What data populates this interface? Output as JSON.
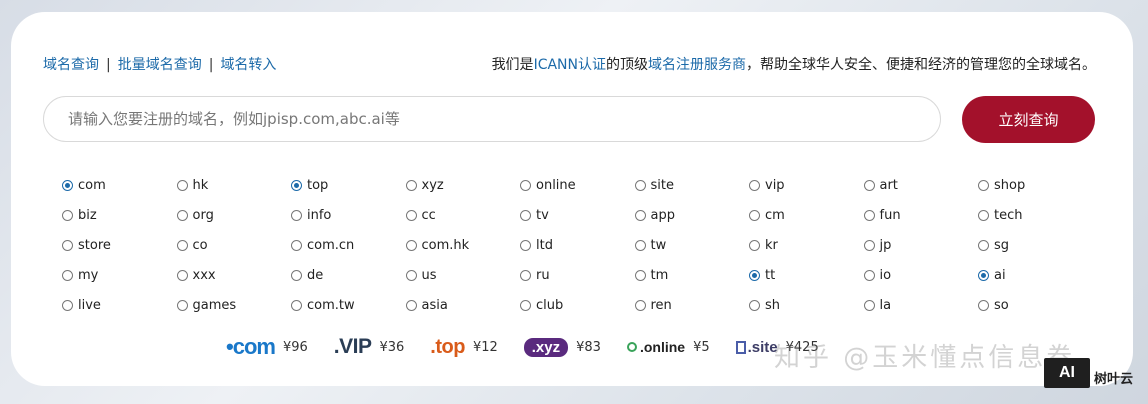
{
  "nav": {
    "links": [
      "域名查询",
      "批量域名查询",
      "域名转入"
    ],
    "separator": "|"
  },
  "slogan": {
    "pre": "我们是",
    "h1": "ICANN认证",
    "mid": "的顶级",
    "h2": "域名注册服务商",
    "post": "，帮助全球华人安全、便捷和经济的管理您的全球域名。"
  },
  "search": {
    "placeholder": "请输入您要注册的域名，例如jpisp.com,abc.ai等",
    "value": "",
    "button": "立刻查询"
  },
  "suffixes": [
    {
      "name": "com",
      "checked": true
    },
    {
      "name": "hk",
      "checked": false
    },
    {
      "name": "top",
      "checked": true
    },
    {
      "name": "xyz",
      "checked": false
    },
    {
      "name": "online",
      "checked": false
    },
    {
      "name": "site",
      "checked": false
    },
    {
      "name": "vip",
      "checked": false
    },
    {
      "name": "art",
      "checked": false
    },
    {
      "name": "shop",
      "checked": false
    },
    {
      "name": "biz",
      "checked": false
    },
    {
      "name": "org",
      "checked": false
    },
    {
      "name": "info",
      "checked": false
    },
    {
      "name": "cc",
      "checked": false
    },
    {
      "name": "tv",
      "checked": false
    },
    {
      "name": "app",
      "checked": false
    },
    {
      "name": "cm",
      "checked": false
    },
    {
      "name": "fun",
      "checked": false
    },
    {
      "name": "tech",
      "checked": false
    },
    {
      "name": "store",
      "checked": false
    },
    {
      "name": "co",
      "checked": false
    },
    {
      "name": "com.cn",
      "checked": false
    },
    {
      "name": "com.hk",
      "checked": false
    },
    {
      "name": "ltd",
      "checked": false
    },
    {
      "name": "tw",
      "checked": false
    },
    {
      "name": "kr",
      "checked": false
    },
    {
      "name": "jp",
      "checked": false
    },
    {
      "name": "sg",
      "checked": false
    },
    {
      "name": "my",
      "checked": false
    },
    {
      "name": "xxx",
      "checked": false
    },
    {
      "name": "de",
      "checked": false
    },
    {
      "name": "us",
      "checked": false
    },
    {
      "name": "ru",
      "checked": false
    },
    {
      "name": "tm",
      "checked": false
    },
    {
      "name": "tt",
      "checked": true
    },
    {
      "name": "io",
      "checked": false
    },
    {
      "name": "ai",
      "checked": true
    },
    {
      "name": "live",
      "checked": false
    },
    {
      "name": "games",
      "checked": false
    },
    {
      "name": "com.tw",
      "checked": false
    },
    {
      "name": "asia",
      "checked": false
    },
    {
      "name": "club",
      "checked": false
    },
    {
      "name": "ren",
      "checked": false
    },
    {
      "name": "sh",
      "checked": false
    },
    {
      "name": "la",
      "checked": false
    },
    {
      "name": "so",
      "checked": false
    }
  ],
  "prices": [
    {
      "logo": "•com",
      "price": "¥96"
    },
    {
      "logo": ".VIP",
      "price": "¥36"
    },
    {
      "logo": ".top",
      "price": "¥12"
    },
    {
      "logo": ".xyz",
      "price": "¥83"
    },
    {
      "logo": ".online",
      "price": "¥5"
    },
    {
      "logo": ".site",
      "price": "¥425"
    }
  ],
  "watermark": "知乎 @玉米懂点信息卷",
  "badge": {
    "logo": "AI",
    "text": "树叶云"
  },
  "colors": {
    "accent": "#1c6aa9",
    "button": "#a3112b"
  }
}
